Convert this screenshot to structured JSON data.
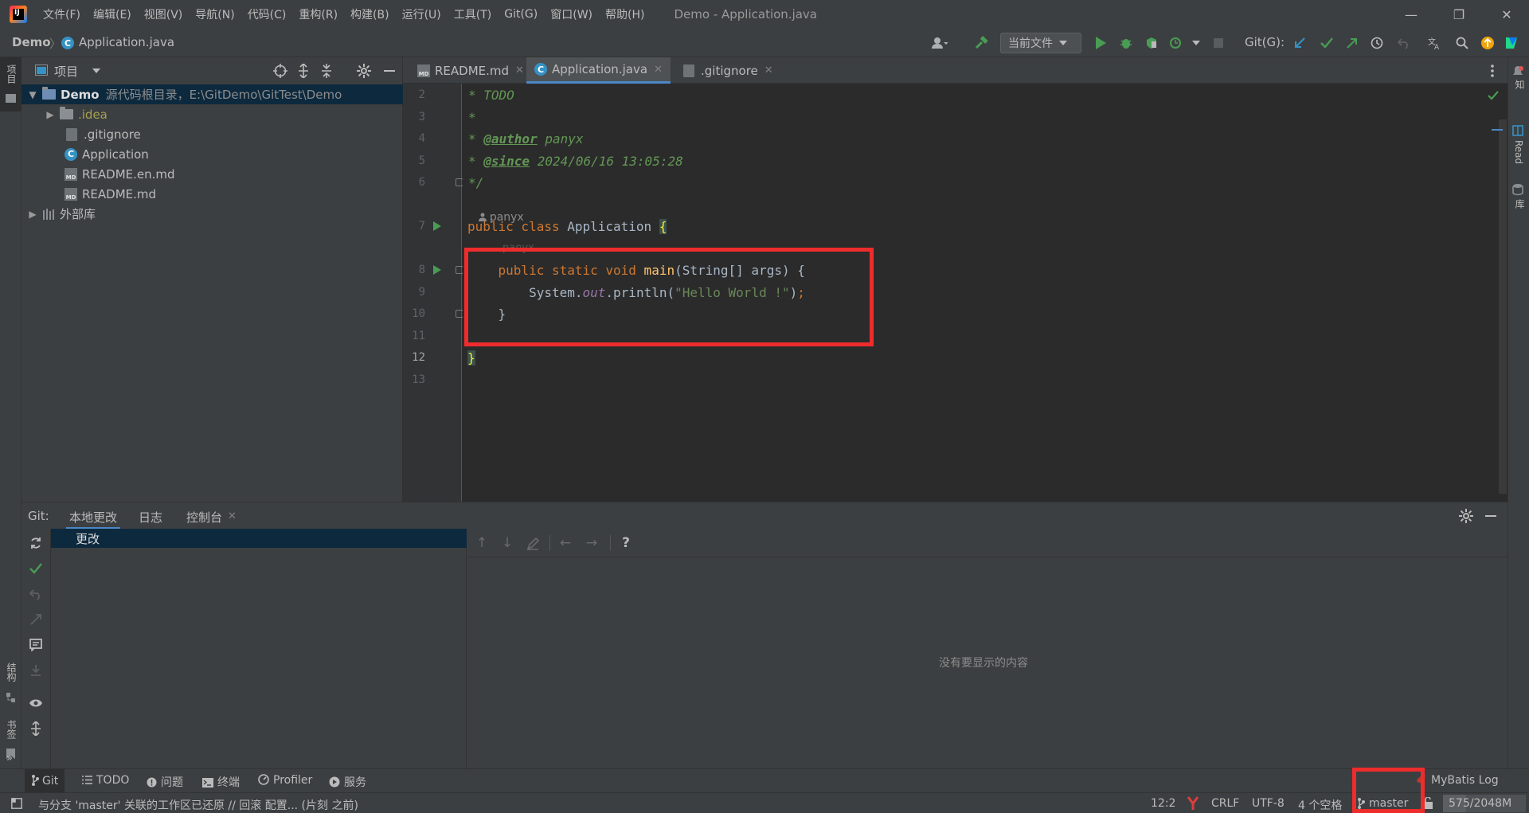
{
  "app": {
    "logo_text": "IJ",
    "window_title": "Demo - Application.java",
    "menu": [
      "文件(F)",
      "编辑(E)",
      "视图(V)",
      "导航(N)",
      "代码(C)",
      "重构(R)",
      "构建(B)",
      "运行(U)",
      "工具(T)",
      "Git(G)",
      "窗口(W)",
      "帮助(H)"
    ],
    "window_controls": [
      "—",
      "❐",
      "✕"
    ]
  },
  "navbar": {
    "breadcrumb_project": "Demo",
    "breadcrumb_sep": "〉",
    "breadcrumb_file": "Application.java",
    "file_badge": "C",
    "run_config": "当前文件",
    "git_label": "Git(G):"
  },
  "left_stripe": {
    "project_tab": "项目",
    "structure_tab": "结构",
    "bookmarks_tab": "书签",
    "more": "»"
  },
  "right_stripe": {
    "notifications_tab": "通知",
    "read_tab": "Read",
    "database_tab": "数据库"
  },
  "project": {
    "title": "项目",
    "tree": {
      "root_name": "Demo",
      "root_hint": "源代码根目录，E:\\GitDemo\\GitTest\\Demo",
      "idea": ".idea",
      "gitignore": ".gitignore",
      "application": "Application",
      "readme_en": "README.en.md",
      "readme": "README.md",
      "external_libs": "外部库",
      "md_badge": "MD",
      "class_badge": "C"
    }
  },
  "editor": {
    "tabs": [
      {
        "label": "README.md"
      },
      {
        "label": "Application.java"
      },
      {
        "label": ".gitignore"
      }
    ],
    "tab_close": "✕",
    "line_numbers": [
      "2",
      "3",
      "4",
      "5",
      "6",
      "7",
      "8",
      "9",
      "10",
      "11",
      "12",
      "13"
    ],
    "author_hint": "panyx",
    "author_hint_faded": "panyx",
    "code": {
      "l2": "* TODO",
      "l3": "*",
      "l4_star": "* ",
      "l4_tag": "@author",
      "l4_val": " panyx",
      "l5_star": "* ",
      "l5_tag": "@since",
      "l5_val": " 2024/06/16 13:05:28",
      "l6": "*/",
      "l7_kw": "public class",
      "l7_name": " Application ",
      "l7_brace": "{",
      "l8_kw": "    public static void",
      "l8_fn": " main",
      "l8_rest": "(String[] args) {",
      "l9_a": "        System.",
      "l9_out": "out",
      "l9_b": ".println(",
      "l9_str": "\"Hello World !\"",
      "l9_c": ")",
      "l9_semi": ";",
      "l10": "    }",
      "l12": "}"
    }
  },
  "git_window": {
    "prefix": "Git:",
    "tabs": [
      "本地更改",
      "日志",
      "控制台"
    ],
    "changes_node": "更改",
    "empty_text": "没有要显示的内容",
    "help": "?"
  },
  "tool_bar": {
    "git": "Git",
    "todo": "TODO",
    "problems": "问题",
    "terminal": "终端",
    "profiler": "Profiler",
    "services": "服务",
    "mybatis": "MyBatis Log"
  },
  "status": {
    "message": "与分支 'master' 关联的工作区已还原 // 回滚   配置... (片刻 之前)",
    "position": "12:2",
    "line_sep": "CRLF",
    "encoding": "UTF-8",
    "indent": "4 个空格",
    "branch": "master",
    "memory": "575/2048M"
  },
  "colors": {
    "highlight_box": "#ee2c2c",
    "accent_blue": "#4a88c7",
    "run_green": "#499c54"
  }
}
